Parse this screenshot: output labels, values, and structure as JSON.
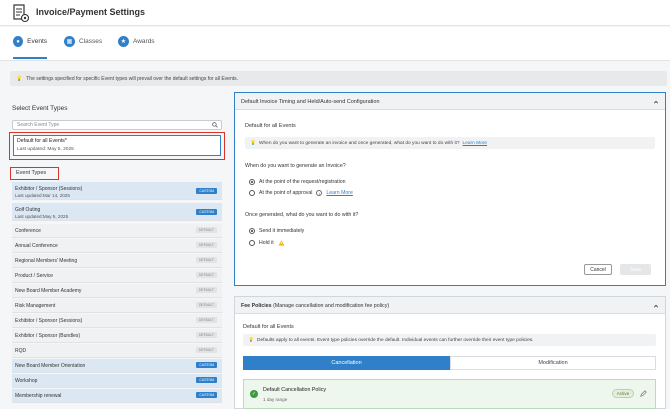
{
  "header": {
    "title": "Invoice/Payment Settings",
    "icon": "document-settings-icon"
  },
  "tabs": [
    {
      "label": "Events",
      "icon": "events-icon",
      "active": true
    },
    {
      "label": "Classes",
      "icon": "classes-icon",
      "active": false
    },
    {
      "label": "Awards",
      "icon": "awards-icon",
      "active": false
    }
  ],
  "info_banner": {
    "text": "The settings specified for specific Event types will prevail over the default settings for all Events.",
    "icon": "lightbulb-icon"
  },
  "left": {
    "title": "Select Event Types",
    "search_placeholder": "Search Event Type",
    "default_item": {
      "name": "Default for all Events*",
      "updated": "Last updated: May 5, 2025"
    },
    "event_types_label": "Event Types",
    "items": [
      {
        "name": "Exhibitor / Sponsor (Sessions)",
        "updated": "Last updated:Mar 14, 2025",
        "badge": "CUSTOM"
      },
      {
        "name": "Golf Outing",
        "updated": "Last updated:May 5, 2025",
        "badge": "CUSTOM"
      },
      {
        "name": "Conference",
        "updated": "",
        "badge": "DEFAULT"
      },
      {
        "name": "Annual Conference",
        "updated": "",
        "badge": "DEFAULT"
      },
      {
        "name": "Regional Members' Meeting",
        "updated": "",
        "badge": "DEFAULT"
      },
      {
        "name": "Product / Service",
        "updated": "",
        "badge": "DEFAULT"
      },
      {
        "name": "New Board Member Academy",
        "updated": "",
        "badge": "DEFAULT"
      },
      {
        "name": "Risk Management",
        "updated": "",
        "badge": "DEFAULT"
      },
      {
        "name": "Exhibitor / Sponsor (Sessions)",
        "updated": "",
        "badge": "DEFAULT"
      },
      {
        "name": "Exhibitor / Sponsor (Bundles)",
        "updated": "",
        "badge": "DEFAULT"
      },
      {
        "name": "RQD",
        "updated": "",
        "badge": "DEFAULT"
      },
      {
        "name": "New Board Member Orientation",
        "updated": "",
        "badge": "CUSTOM"
      },
      {
        "name": "Workshop",
        "updated": "",
        "badge": "CUSTOM"
      },
      {
        "name": "Membership renewal",
        "updated": "",
        "badge": "CUSTOM"
      }
    ]
  },
  "timing_panel": {
    "title": "Default Invoice Timing and Held/Auto-send Configuration",
    "subtitle": "Default for all Events",
    "help_text": "When do you want to generate an invoice and once generated, what do you want to do with it?",
    "help_link": "Learn More",
    "q1": "When do you want to generate an Invoice?",
    "q1_options": [
      {
        "label": "At the point of the request/registration",
        "selected": true
      },
      {
        "label": "At the point of approval",
        "selected": false,
        "link": "Learn More"
      }
    ],
    "q2": "Once generated, what do you want to do with it?",
    "q2_options": [
      {
        "label": "Send it immediately",
        "selected": true
      },
      {
        "label": "Hold it",
        "selected": false
      }
    ],
    "cancel_label": "Cancel",
    "save_label": "Save"
  },
  "fee_panel": {
    "title_bold": "Fee Policies",
    "title_rest": "(Manage cancellation and modification fee policy)",
    "subtitle": "Default for all Events",
    "help_text": "Defaults apply to all events. Event type policies override the default. Individual events can further override their event type policies.",
    "tab_cancellation": "Cancellation",
    "tab_modification": "Modification",
    "policy_name": "Default Cancellation Policy",
    "policy_range": "1 day range",
    "policy_status": "Active"
  },
  "colors": {
    "accent": "#2f80c9",
    "highlight_outline": "#d9342b",
    "success": "#3c9b3c"
  }
}
